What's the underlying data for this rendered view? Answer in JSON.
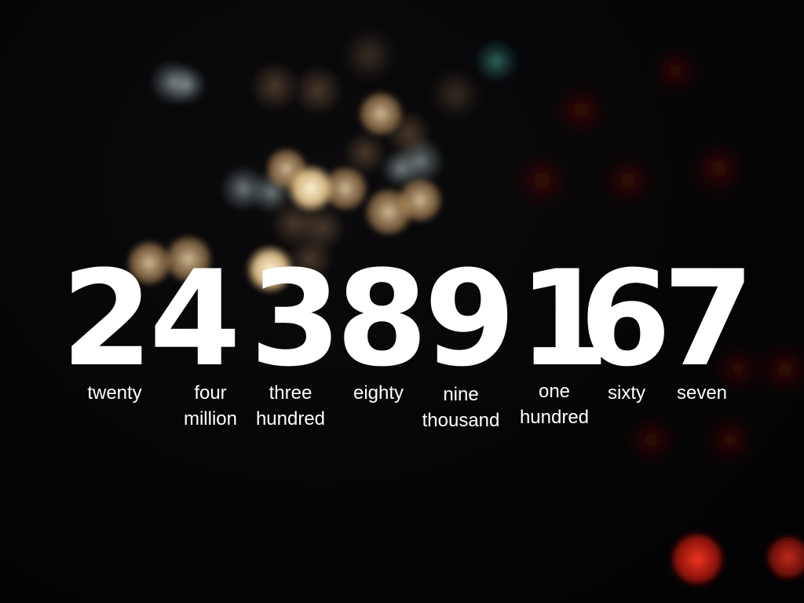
{
  "number": {
    "digits": [
      "2",
      "4",
      "3",
      "8",
      "9",
      "1",
      "6",
      "7"
    ]
  },
  "place_words": [
    {
      "line1": "twenty",
      "line2": ""
    },
    {
      "line1": "four",
      "line2": "million"
    },
    {
      "line1": "three",
      "line2": "hundred"
    },
    {
      "line1": "eighty",
      "line2": ""
    },
    {
      "line1": "nine",
      "line2": "thousand"
    },
    {
      "line1": "one",
      "line2": "hundred"
    },
    {
      "line1": "sixty",
      "line2": ""
    },
    {
      "line1": "seven",
      "line2": ""
    }
  ],
  "colors": {
    "background": "#040406",
    "text": "#ffffff",
    "bokeh_warm": "#e8c48a",
    "bokeh_cool": "#9fb2b4",
    "bokeh_teal": "#3a8a7e",
    "bokeh_red": "#e0281a"
  }
}
